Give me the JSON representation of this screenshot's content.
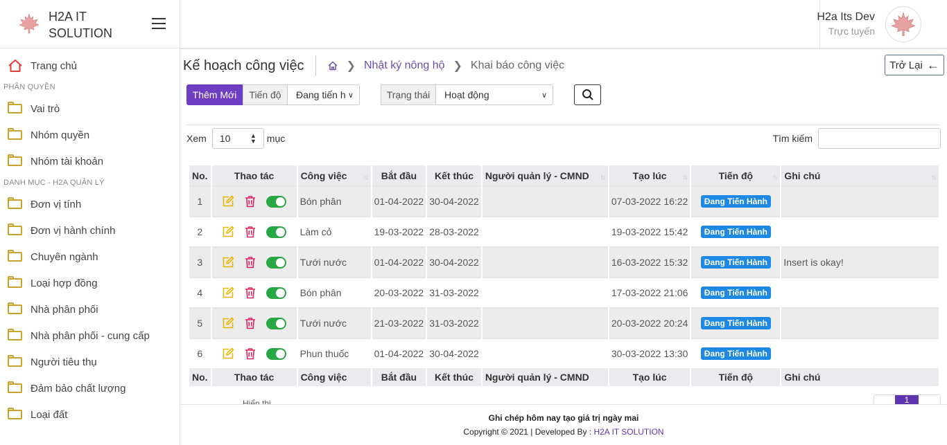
{
  "brand": {
    "name": "H2A IT SOLUTION"
  },
  "user": {
    "name": "H2a Its Dev",
    "status": "Trực tuyến"
  },
  "sidebar": {
    "home": "Trang chủ",
    "section1": "PHÂN QUYỀN",
    "group1": [
      "Vai trò",
      "Nhóm quyền",
      "Nhóm tài khoản"
    ],
    "section2": "DANH MỤC - H2A QUẢN LÝ",
    "group2": [
      "Đơn vị tính",
      "Đơn vị hành chính",
      "Chuyên ngành",
      "Loại hợp đồng",
      "Nhà phân phối",
      "Nhà phân phối - cung cấp",
      "Người tiêu thụ",
      "Đảm bảo chất lượng",
      "Loại đất"
    ]
  },
  "page": {
    "title": "Kế hoạch công việc",
    "breadcrumb_link": "Nhật ký nông hộ",
    "breadcrumb_current": "Khai báo công việc",
    "back_label": "Trở Lại"
  },
  "filters": {
    "add_label": "Thêm Mới",
    "progress_label": "Tiến độ",
    "progress_value": "Đang tiến h",
    "status_label": "Trạng thái",
    "status_value": "Hoạt động"
  },
  "table_controls": {
    "show_label": "Xem",
    "page_size": "10",
    "entries_label": "mục",
    "search_label": "Tìm kiếm"
  },
  "table": {
    "headers": [
      "No.",
      "Thao tác",
      "Công việc",
      "Bắt đầu",
      "Kết thúc",
      "Người quản lý - CMND",
      "Tạo lúc",
      "Tiến độ",
      "Ghi chú"
    ],
    "rows": [
      {
        "no": "1",
        "task": "Bón phân",
        "start": "01-04-2022",
        "end": "30-04-2022",
        "manager": "",
        "created": "07-03-2022 16:22",
        "progress": "Đang Tiến Hành",
        "note": ""
      },
      {
        "no": "2",
        "task": "Làm cỏ",
        "start": "19-03-2022",
        "end": "28-03-2022",
        "manager": "",
        "created": "19-03-2022 15:42",
        "progress": "Đang Tiến Hành",
        "note": ""
      },
      {
        "no": "3",
        "task": "Tưới nước",
        "start": "01-04-2022",
        "end": "30-04-2022",
        "manager": "",
        "created": "16-03-2022 15:32",
        "progress": "Đang Tiến Hành",
        "note": "Insert is okay!"
      },
      {
        "no": "4",
        "task": "Bón phân",
        "start": "20-03-2022",
        "end": "31-03-2022",
        "manager": "",
        "created": "17-03-2022 21:06",
        "progress": "Đang Tiến Hành",
        "note": ""
      },
      {
        "no": "5",
        "task": "Tưới nước",
        "start": "21-03-2022",
        "end": "31-03-2022",
        "manager": "",
        "created": "20-03-2022 20:24",
        "progress": "Đang Tiến Hành",
        "note": ""
      },
      {
        "no": "6",
        "task": "Phun thuốc",
        "start": "01-04-2022",
        "end": "30-04-2022",
        "manager": "",
        "created": "30-03-2022 13:30",
        "progress": "Đang Tiến Hành",
        "note": ""
      }
    ]
  },
  "pagination": {
    "current": "1",
    "info_partial": "Hiển thị"
  },
  "footer": {
    "slogan": "Ghi chép hôm nay tạo giá trị ngày mai",
    "copyright": "Copyright © 2021 | Developed By : ",
    "developer": "H2A IT SOLUTION"
  },
  "colors": {
    "primary": "#6f3cc4",
    "badge": "#1e88e5",
    "toggle_on": "#28a745",
    "edit_icon": "#f0b400",
    "delete_icon": "#e0245e",
    "folder_icon": "#c9a227",
    "home_icon": "#e53935"
  },
  "icons": {
    "logo": "maple-leaf-icon",
    "menu": "hamburger-icon",
    "home": "home-icon",
    "folder": "folder-icon",
    "search": "search-icon",
    "back": "arrow-left-icon",
    "edit": "edit-icon",
    "delete": "trash-icon",
    "toggle": "toggle-switch"
  }
}
